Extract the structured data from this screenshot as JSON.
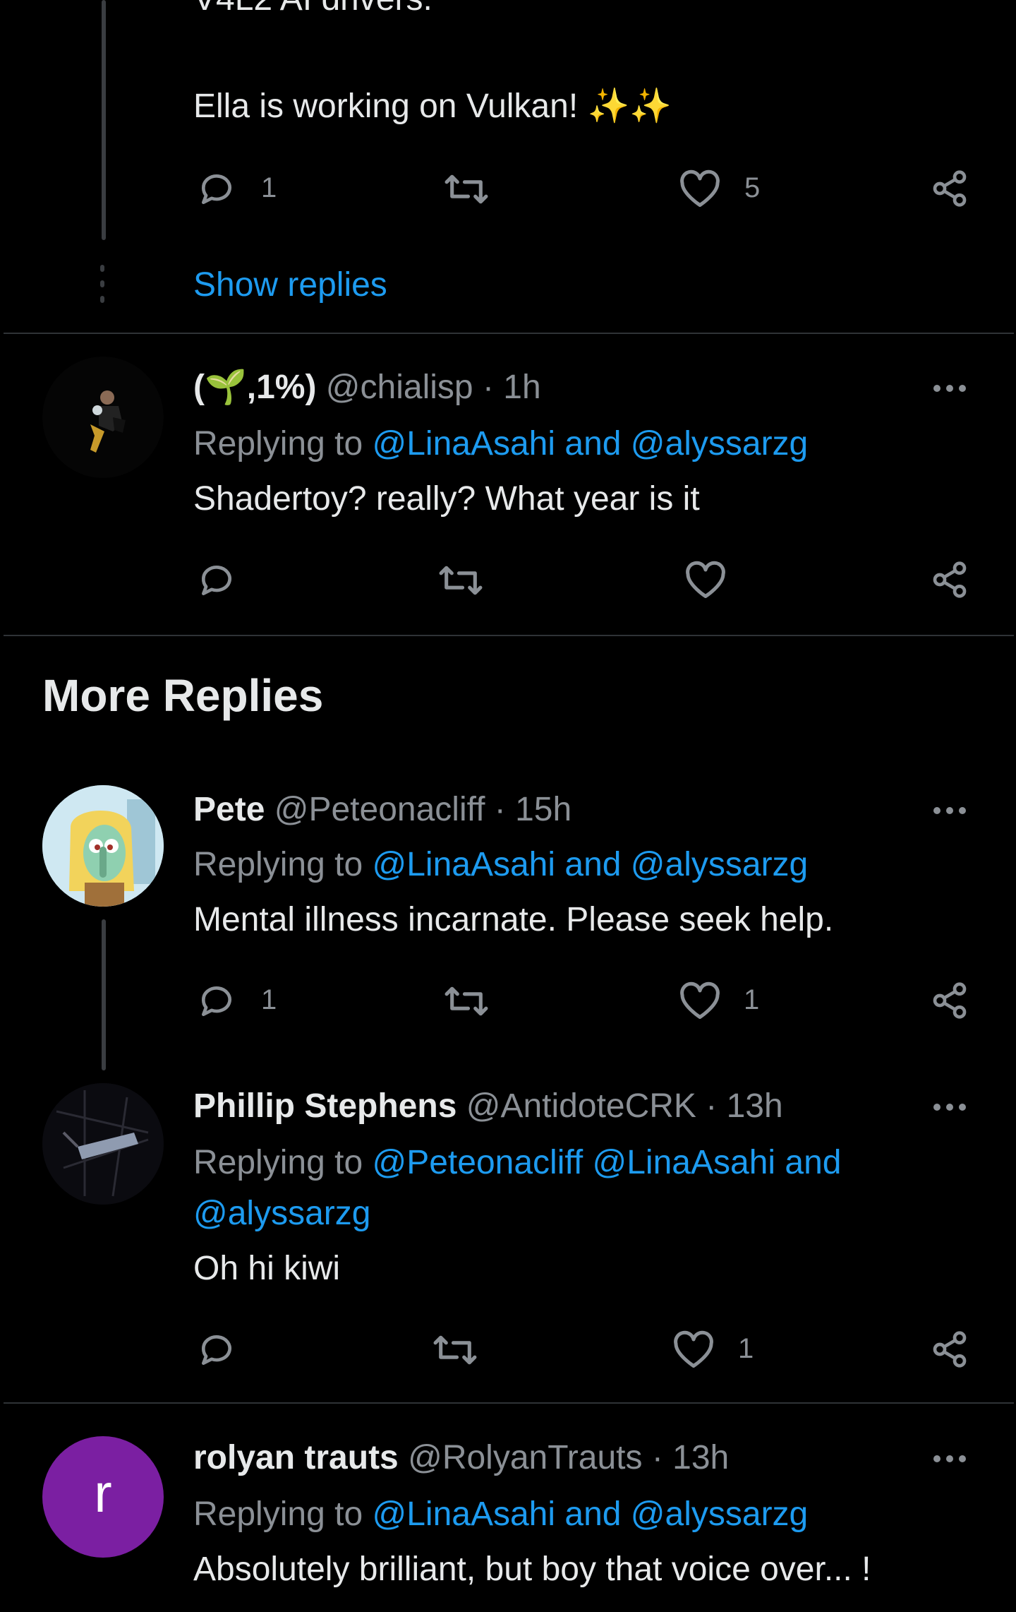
{
  "tweet0": {
    "text_cut": "V4L2 AI drivers.",
    "text": "Ella is working on Vulkan!",
    "emoji": "✨✨",
    "reply_count": "1",
    "like_count": "5",
    "show_replies": "Show replies"
  },
  "reply_chialisp": {
    "display_name": "(🌱,1%)",
    "handle": "@chialisp",
    "time": "· 1h",
    "replying_prefix": "Replying to",
    "replying_to": "@LinaAsahi and @alyssarzg",
    "text": "Shadertoy? really? What year is it"
  },
  "more_replies_title": "More Replies",
  "reply_pete": {
    "display_name": "Pete",
    "handle": "@Peteonacliff",
    "time": "· 15h",
    "replying_prefix": "Replying to",
    "replying_to": "@LinaAsahi and @alyssarzg",
    "text": "Mental illness incarnate. Please seek help.",
    "reply_count": "1",
    "like_count": "1"
  },
  "reply_phillip": {
    "display_name": "Phillip Stephens",
    "handle": "@AntidoteCRK",
    "time": "· 13h",
    "replying_prefix": "Replying to",
    "replying_to_line1": "@Peteonacliff @LinaAsahi and",
    "replying_to_line2": "@alyssarzg",
    "text": "Oh hi kiwi",
    "like_count": "1"
  },
  "reply_rolyan": {
    "avatar_letter": "r",
    "display_name": "rolyan trauts",
    "handle": "@RolyanTrauts",
    "time": "· 13h",
    "replying_prefix": "Replying to",
    "replying_to": "@LinaAsahi and @alyssarzg",
    "text": "Absolutely brilliant, but boy that voice over... !"
  },
  "colors": {
    "background": "#000000",
    "text": "#e7e9ea",
    "muted": "#8b9096",
    "link": "#1d9bf0",
    "avatar_purple": "#7b1fa2"
  },
  "icons": [
    "reply-icon",
    "retweet-icon",
    "like-icon",
    "share-icon",
    "more-icon"
  ]
}
